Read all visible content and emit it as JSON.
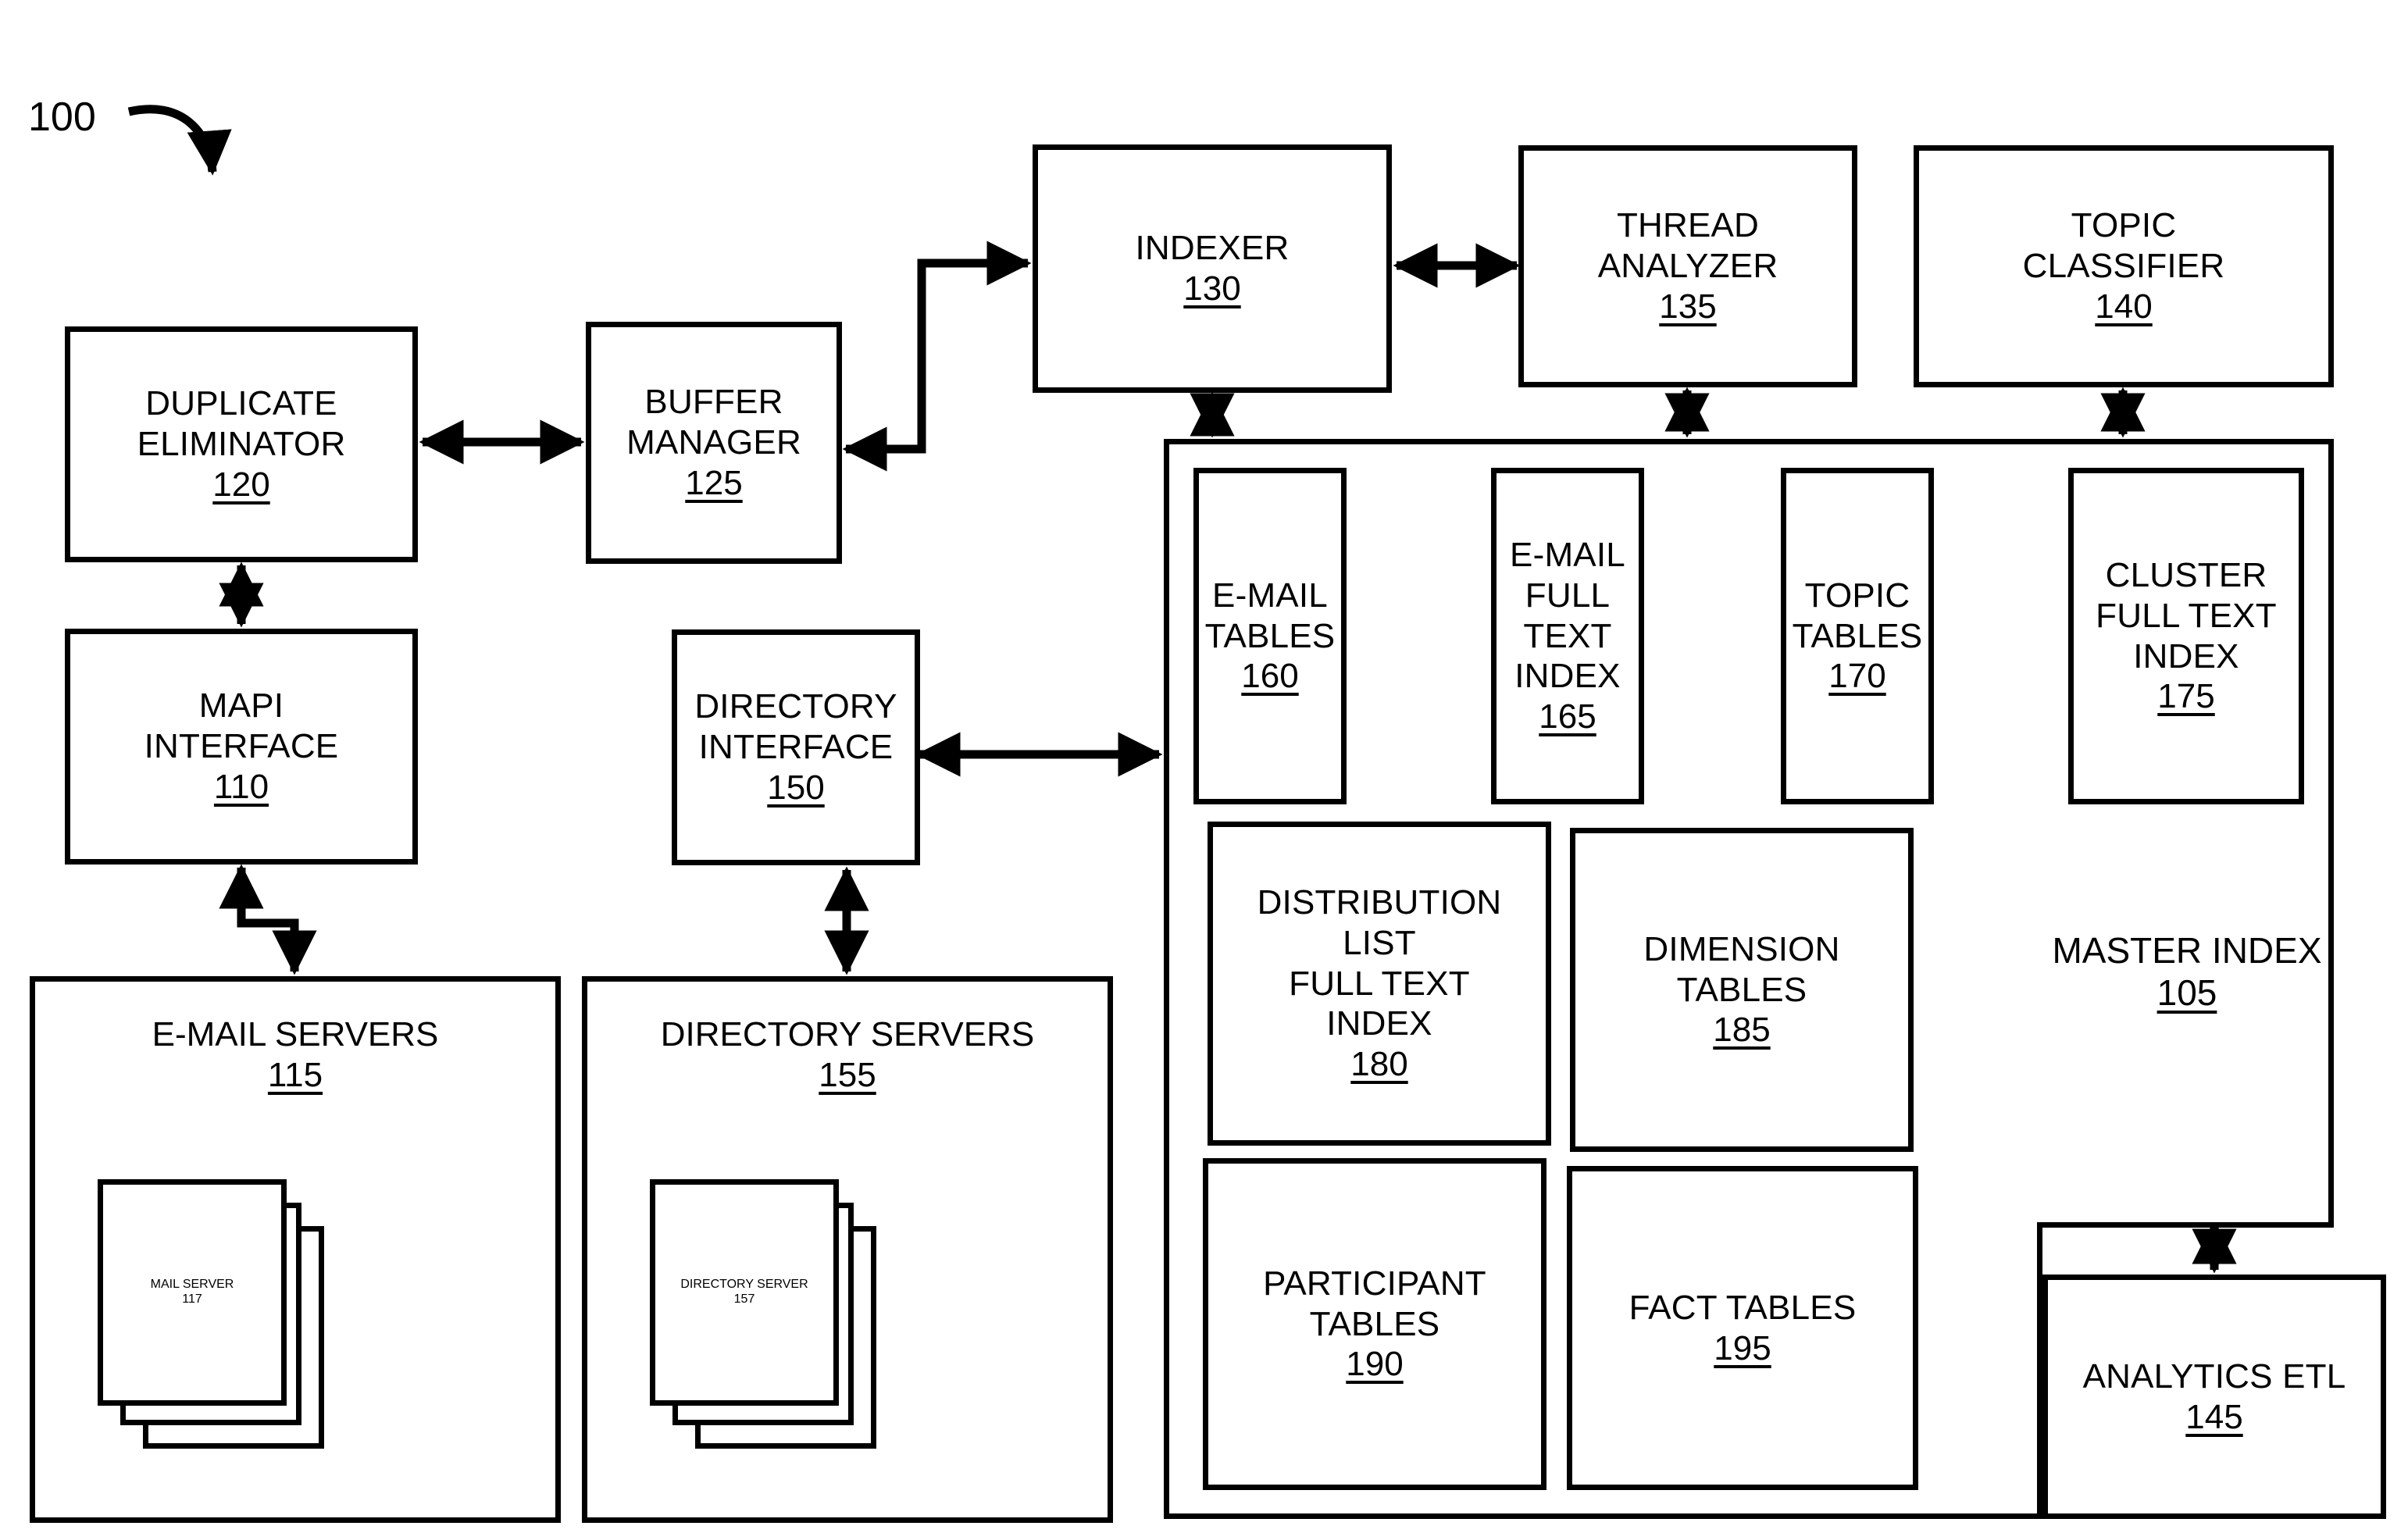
{
  "figure": {
    "number": "100"
  },
  "boxes": {
    "duplicate_eliminator": {
      "title": "DUPLICATE\nELIMINATOR",
      "ref": "120"
    },
    "buffer_manager": {
      "title": "BUFFER\nMANAGER",
      "ref": "125"
    },
    "indexer": {
      "title": "INDEXER",
      "ref": "130"
    },
    "thread_analyzer": {
      "title": "THREAD\nANALYZER",
      "ref": "135"
    },
    "topic_classifier": {
      "title": "TOPIC\nCLASSIFIER",
      "ref": "140"
    },
    "mapi_interface": {
      "title": "MAPI\nINTERFACE",
      "ref": "110"
    },
    "directory_interface": {
      "title": "DIRECTORY\nINTERFACE",
      "ref": "150"
    },
    "analytics_etl": {
      "title": "ANALYTICS ETL",
      "ref": "145"
    },
    "email_servers": {
      "title": "E-MAIL SERVERS",
      "ref": "115"
    },
    "mail_server": {
      "title": "MAIL SERVER",
      "ref": "117"
    },
    "directory_servers": {
      "title": "DIRECTORY SERVERS",
      "ref": "155"
    },
    "directory_server": {
      "title": "DIRECTORY\nSERVER",
      "ref": "157"
    },
    "master_index": {
      "title": "MASTER INDEX",
      "ref": "105"
    },
    "email_tables": {
      "title": "E-MAIL\nTABLES",
      "ref": "160"
    },
    "email_full_text_index": {
      "title": "E-MAIL\nFULL TEXT\nINDEX",
      "ref": "165"
    },
    "topic_tables": {
      "title": "TOPIC\nTABLES",
      "ref": "170"
    },
    "cluster_full_text_index": {
      "title": "CLUSTER\nFULL TEXT\nINDEX",
      "ref": "175"
    },
    "distribution_list_full_text_index": {
      "title": "DISTRIBUTION\nLIST\nFULL TEXT\nINDEX",
      "ref": "180"
    },
    "dimension_tables": {
      "title": "DIMENSION\nTABLES",
      "ref": "185"
    },
    "participant_tables": {
      "title": "PARTICIPANT\nTABLES",
      "ref": "190"
    },
    "fact_tables": {
      "title": "FACT TABLES",
      "ref": "195"
    }
  },
  "colors": {
    "stroke": "#000000",
    "background": "#ffffff"
  }
}
